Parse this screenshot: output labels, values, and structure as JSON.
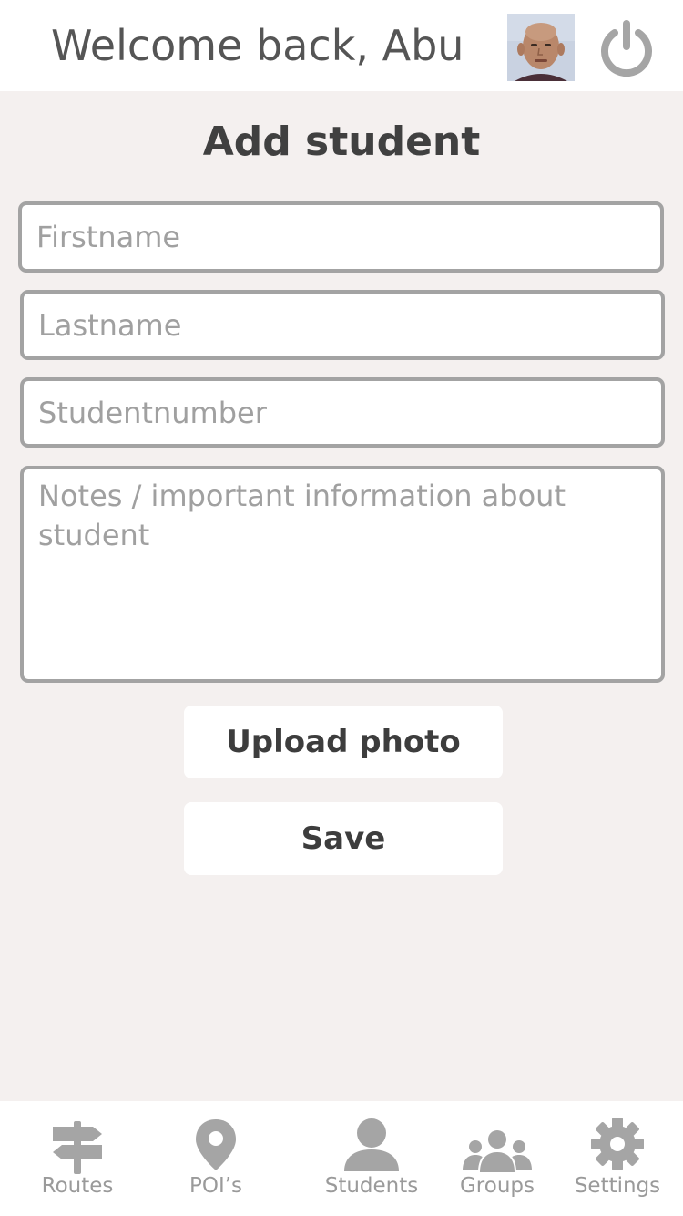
{
  "header": {
    "welcome_text": "Welcome back, Abu"
  },
  "page": {
    "title": "Add student"
  },
  "form": {
    "firstname_placeholder": "Firstname",
    "lastname_placeholder": "Lastname",
    "studentnumber_placeholder": "Studentnumber",
    "notes_placeholder": "Notes / important information about student",
    "upload_label": "Upload photo",
    "save_label": "Save"
  },
  "tabs": [
    {
      "label": "Routes",
      "icon": "signpost-icon"
    },
    {
      "label": "POI’s",
      "icon": "map-pin-icon"
    },
    {
      "label": "Students",
      "icon": "person-icon"
    },
    {
      "label": "Groups",
      "icon": "group-icon"
    },
    {
      "label": "Settings",
      "icon": "gear-icon"
    }
  ],
  "colors": {
    "background": "#f4f0ef",
    "icon_gray": "#a5a5a5",
    "field_border": "#a3a3a3",
    "text_dark": "#404040"
  }
}
